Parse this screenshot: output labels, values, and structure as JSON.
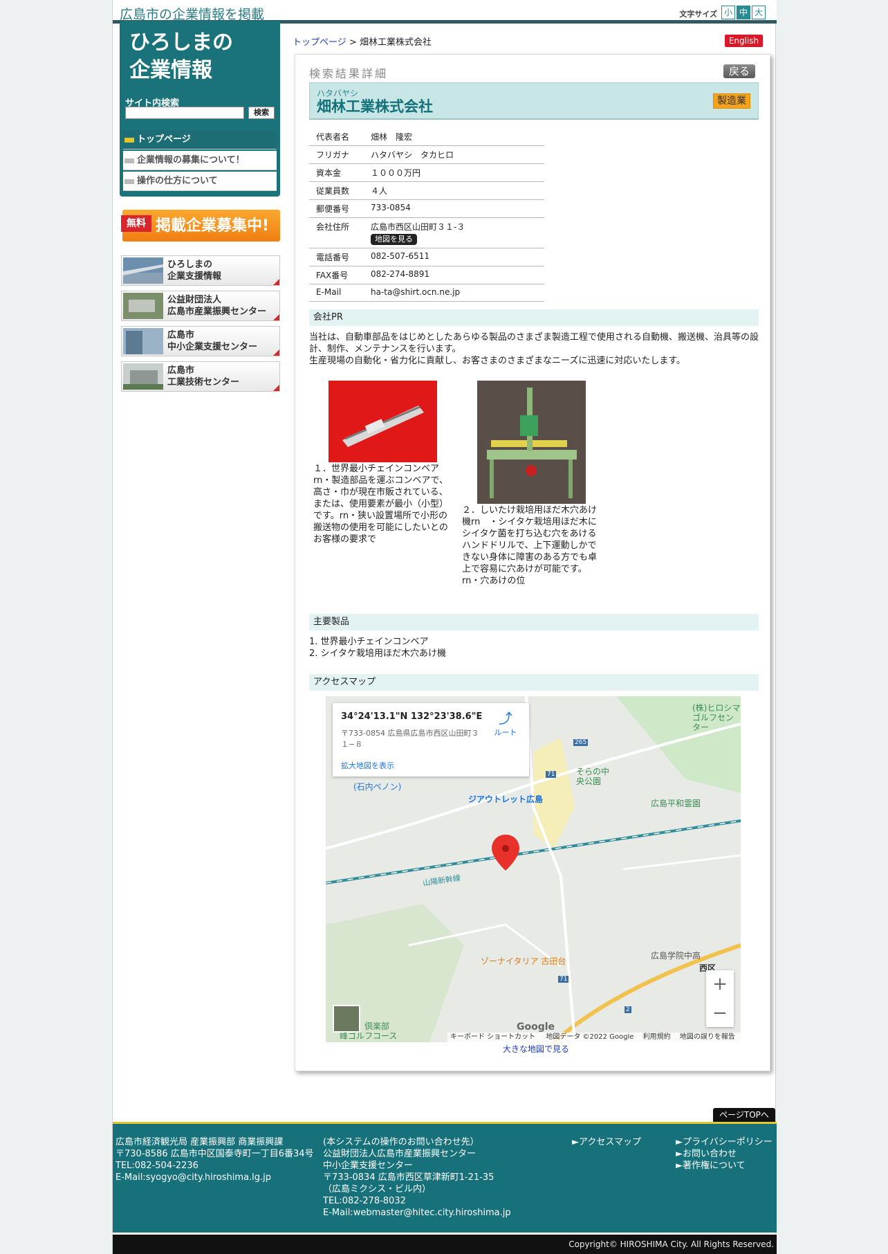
{
  "header": {
    "tagline": "広島市の企業情報を掲載",
    "font_size_label": "文字サイズ",
    "font_sizes": [
      "小",
      "中",
      "大"
    ]
  },
  "sidebar": {
    "brand_title": "ひろしまの\n企業情報",
    "search_label": "サイト内検索",
    "search_placeholder": "",
    "search_button": "検索",
    "nav": [
      "トップページ",
      "企業情報の募集について！",
      "操作の仕方について"
    ],
    "recruit_free": "無料",
    "recruit_text": "掲載企業募集中!",
    "links": [
      {
        "line1": "ひろしまの",
        "line2": "企業支援情報"
      },
      {
        "line1": "公益財団法人",
        "line2": "広島市産業振興センター"
      },
      {
        "line1": "広島市",
        "line2": "中小企業支援センター"
      },
      {
        "line1": "広島市",
        "line2": "工業技術センター"
      }
    ]
  },
  "breadcrumb": {
    "home": "トップページ",
    "separator": ">",
    "current": "畑林工業株式会社"
  },
  "english_label": "English",
  "detail": {
    "heading": "検索結果詳細",
    "back_label": "戻る",
    "company_kana": "ハタバヤシ",
    "company_name": "畑林工業株式会社",
    "industry": "製造業",
    "info": [
      {
        "key": "代表者名",
        "value": "畑林　隆宏"
      },
      {
        "key": "フリガナ",
        "value": "ハタバヤシ　タカヒロ"
      },
      {
        "key": "資本金",
        "value": "１０００万円"
      },
      {
        "key": "従業員数",
        "value": "４人"
      },
      {
        "key": "郵便番号",
        "value": "733-0854"
      },
      {
        "key": "会社住所",
        "value": "広島市西区山田町３１-３"
      },
      {
        "key": "電話番号",
        "value": "082-507-6511"
      },
      {
        "key": "FAX番号",
        "value": "082-274-8891"
      },
      {
        "key": "E-Mail",
        "value": "ha-ta@shirt.ocn.ne.jp"
      }
    ],
    "map_view_button": "地図を見る",
    "pr_heading": "会社PR",
    "pr_text": "当社は、自動車部品をはじめとしたあらゆる製品のさまざま製造工程で使用される自動機、搬送機、治具等の設計、制作、メンテナンスを行います。\n生産現場の自動化・省力化に貢献し、お客さまのさまざまなニーズに迅速に対応いたします。",
    "products": [
      {
        "caption": "１．世界最小チェインコンベアrn・製造部品を運ぶコンベアで、高さ・巾が現在市販されている、または、使用要素が最小（小型）です。rn・狭い設置場所で小形の搬送物の使用を可能にしたいとのお客様の要求で"
      },
      {
        "caption": "２．しいたけ栽培用ほだ木穴あけ機rn　・シイタケ栽培用ほだ木にシイタケ菌を打ち込む穴をあけるハンドドリルで、上下運動しかできない身体に障害のある方でも卓上で容易に穴あけが可能です。rn・穴あけの位"
      }
    ],
    "main_products_heading": "主要製品",
    "main_products": [
      "1. 世界最小チェインコンベア",
      "2. シイタケ栽培用ほだ木穴あけ機"
    ],
    "access_heading": "アクセスマップ"
  },
  "map": {
    "coords": "34°24'13.1\"N 132°23'38.6\"E",
    "address": "〒733-0854 広島県広島市西区山田町３１−８",
    "route_label": "ルート",
    "enlarge_label": "拡大地図を表示",
    "labels": {
      "golf": "(株)ヒロシマゴルフセンター",
      "park": "そらの中央公園",
      "outlet": "ジアウトレット広島",
      "cemetery": "広島平和霊園",
      "shinkansen": "山陽新幹線",
      "ishiuchi": "(石内ペノン)",
      "restaurant": "ゾーナイタリア 古田台",
      "school": "広島学院中高",
      "nishiku": "西区",
      "golfclub": "倶楽部",
      "golfcourse": "峰ゴルフコース",
      "route265": "265",
      "route71a": "71",
      "route71b": "71",
      "route2": "2"
    },
    "google": "Google",
    "footer": {
      "shortcuts": "キーボード ショートカット",
      "data": "地図データ ©2022 Google",
      "terms": "利用規約",
      "report": "地図の誤りを報告する"
    },
    "zoom_in": "+",
    "zoom_out": "−",
    "large_map_link": "大きな地図で見る"
  },
  "pagetop_label": "ページTOPへ",
  "footer": {
    "col1": "広島市経済観光局 産業振興部 商業振興課\n〒730-8586 広島市中区国泰寺町一丁目6番34号\nTEL:082-504-2236\nE-Mail:syogyo@city.hiroshima.lg.jp",
    "col2": "(本システムの操作のお問い合わせ先）\n公益財団法人広島市産業振興センター\n中小企業支援センター\n〒733-0834 広島市西区草津新町1-21-35\n（広島ミクシス・ビル内）\nTEL:082-278-8032\nE-Mail:webmaster@hitec.city.hiroshima.jp",
    "col3": "►アクセスマップ",
    "col4": "►プライバシーポリシー\n►お問い合わせ\n►著作権について",
    "copyright": "Copyright© HIROSHIMA City. All Rights Reserved."
  },
  "colors": {
    "teal": "#1a737a",
    "accent_red": "#d81a28",
    "orange": "#f7a21b"
  }
}
